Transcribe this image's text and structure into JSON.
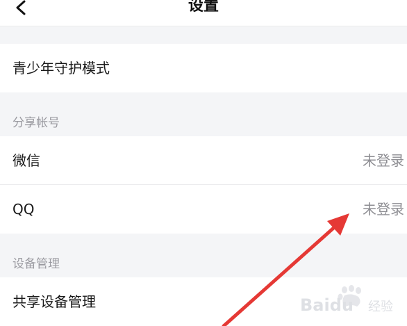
{
  "header": {
    "title": "设置"
  },
  "rows": {
    "teen_mode": {
      "label": "青少年守护模式"
    },
    "wechat": {
      "label": "微信",
      "value": "未登录"
    },
    "qq": {
      "label": "QQ",
      "value": "未登录"
    },
    "shared_devices": {
      "label": "共享设备管理"
    }
  },
  "sections": {
    "share_accounts": "分享帐号",
    "device_management": "设备管理"
  },
  "watermark": {
    "text": "Baidu",
    "subtext": "经验"
  },
  "colors": {
    "arrow": "#e53935",
    "value_text": "#8e8e93",
    "background": "#f4f5f7"
  }
}
